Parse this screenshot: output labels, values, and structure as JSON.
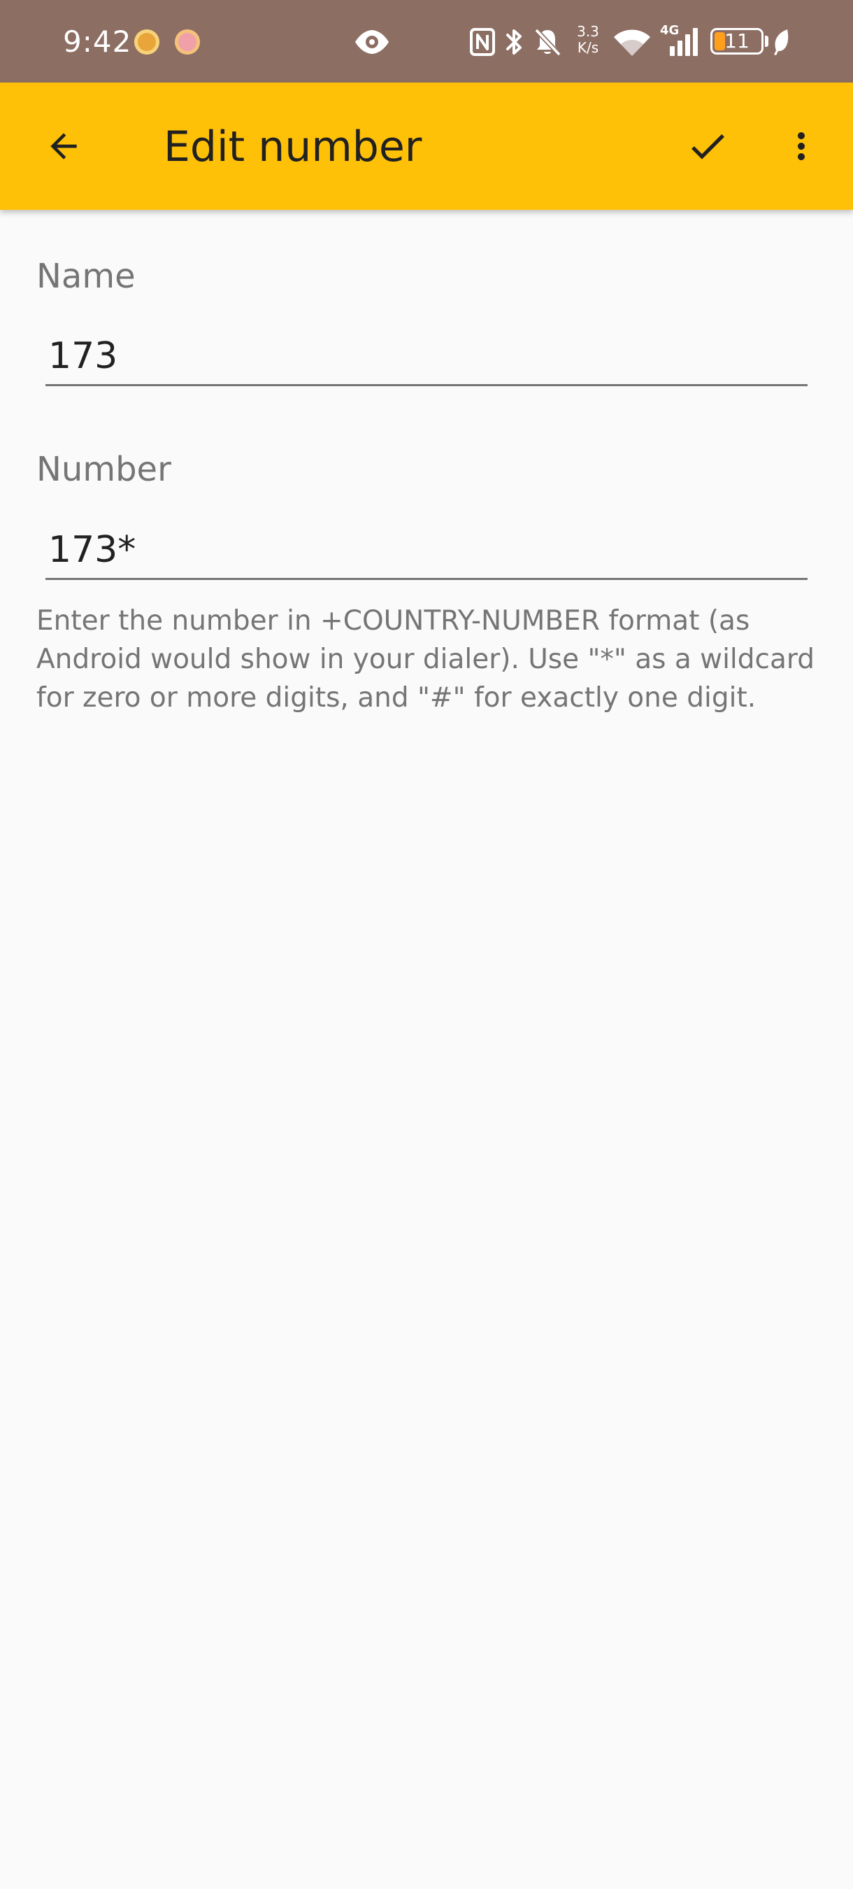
{
  "status_bar": {
    "time": "9:42",
    "network_speed_value": "3.3",
    "network_speed_unit": "K/s",
    "network_type": "4G",
    "battery_level": "11",
    "battery_fraction": 0.11,
    "icons": [
      "notification-app-icon",
      "notification-app-icon",
      "eye-icon",
      "nfc-icon",
      "bluetooth-icon",
      "mute-bell-icon",
      "wifi-icon",
      "signal-icon",
      "battery-icon",
      "leaf-icon"
    ]
  },
  "app_bar": {
    "title": "Edit number",
    "background": "#ffc107",
    "icons": [
      "arrow-back-icon",
      "check-icon",
      "more-vert-icon"
    ]
  },
  "form": {
    "name_label": "Name",
    "name_value": "173",
    "number_label": "Number",
    "number_value": "173*",
    "helper_text": "Enter the number in +COUNTRY-NUMBER format (as Android would show in your dialer). Use \"*\" as a wildcard for zero or more digits, and \"#\" for exactly one digit."
  },
  "colors": {
    "status_bar": "#8d6e63",
    "accent": "#ffc107",
    "background": "#fafafa",
    "text_primary": "#212121",
    "text_secondary": "#757575"
  }
}
